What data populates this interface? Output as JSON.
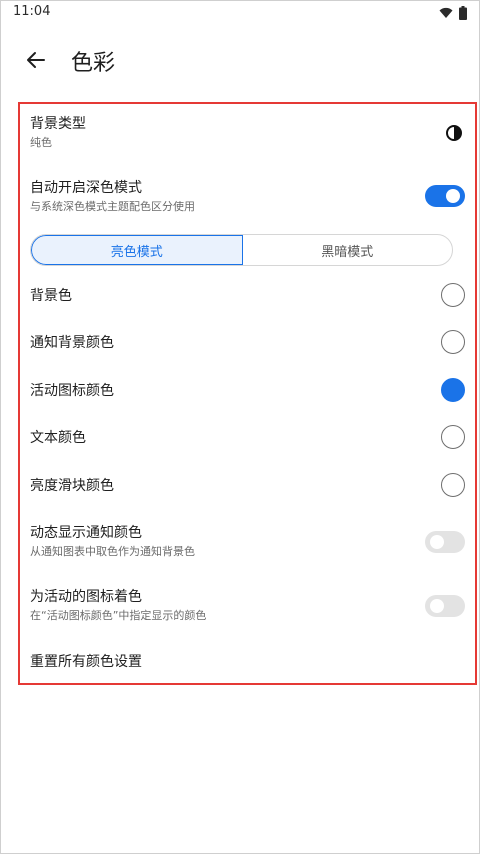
{
  "status_bar": {
    "time": "11:04",
    "icons": [
      "wifi-icon",
      "battery-icon"
    ]
  },
  "header": {
    "title": "色彩",
    "back_icon": "arrow-left-icon"
  },
  "background_type": {
    "title": "背景类型",
    "subtitle": "纯色",
    "icon": "contrast-icon"
  },
  "auto_dark": {
    "title": "自动开启深色模式",
    "subtitle": "与系统深色模式主题配色区分使用",
    "enabled": true
  },
  "mode_tabs": [
    {
      "label": "亮色模式",
      "selected": true
    },
    {
      "label": "黑暗模式",
      "selected": false
    }
  ],
  "color_options": [
    {
      "label": "背景色",
      "selected": false
    },
    {
      "label": "通知背景颜色",
      "selected": false
    },
    {
      "label": "活动图标颜色",
      "selected": true
    },
    {
      "label": "文本颜色",
      "selected": false
    },
    {
      "label": "亮度滑块颜色",
      "selected": false
    }
  ],
  "dynamic_notification": {
    "title": "动态显示通知颜色",
    "subtitle": "从通知图表中取色作为通知背景色",
    "enabled": false
  },
  "tint_active_icons": {
    "title": "为活动的图标着色",
    "subtitle": "在“活动图标颜色”中指定显示的颜色",
    "enabled": false
  },
  "reset": {
    "label": "重置所有颜色设置"
  },
  "colors": {
    "accent": "#1a73e8",
    "highlight_border": "#e53935",
    "toggle_off": "#e3e3e3"
  }
}
